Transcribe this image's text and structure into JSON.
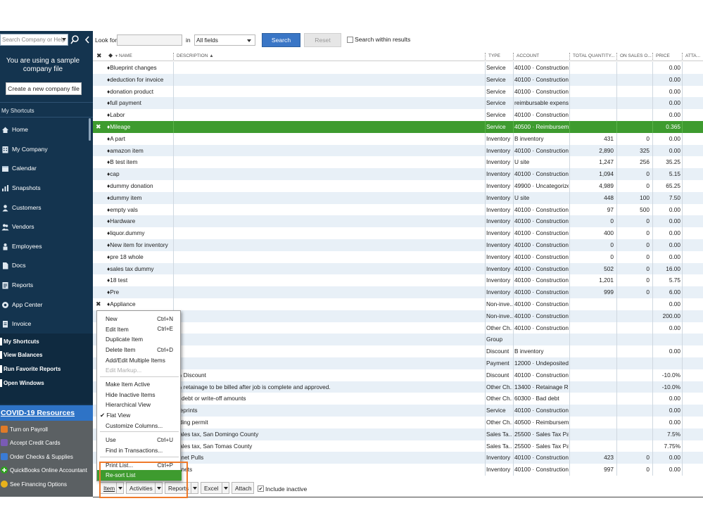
{
  "sidebar": {
    "search_placeholder": "Search Company or Help",
    "sample_notice": "You are using a sample company file",
    "create_button": "Create a new company file",
    "my_shortcuts_heading": "My Shortcuts",
    "nav": [
      {
        "label": "Home",
        "icon": "home-icon"
      },
      {
        "label": "My Company",
        "icon": "building-icon"
      },
      {
        "label": "Calendar",
        "icon": "calendar-icon"
      },
      {
        "label": "Snapshots",
        "icon": "snapshot-icon"
      },
      {
        "label": "Customers",
        "icon": "customer-icon"
      },
      {
        "label": "Vendors",
        "icon": "vendor-icon"
      },
      {
        "label": "Employees",
        "icon": "employee-icon"
      },
      {
        "label": "Docs",
        "icon": "docs-icon"
      },
      {
        "label": "Reports",
        "icon": "reports-icon"
      },
      {
        "label": "App Center",
        "icon": "app-center-icon"
      },
      {
        "label": "Invoice",
        "icon": "invoice-icon"
      }
    ],
    "lower": [
      "My Shortcuts",
      "View Balances",
      "Run Favorite Reports",
      "Open Windows"
    ],
    "covid_heading": "COVID-19 Resources",
    "covid_items": [
      {
        "label": "Turn on Payroll",
        "color": "#e07b28"
      },
      {
        "label": "Accept Credit Cards",
        "color": "#7a5bb5"
      },
      {
        "label": "Order Checks & Supplies",
        "color": "#3a7bd5"
      },
      {
        "label": "QuickBooks Online Accountant",
        "color": "#2ca01c"
      },
      {
        "label": "See Financing Options",
        "color": "#e8b21b"
      }
    ]
  },
  "search": {
    "look_for": "Look for",
    "in": "in",
    "fields_value": "All fields",
    "search_button": "Search",
    "reset_button": "Reset",
    "within_label": "Search within results"
  },
  "table": {
    "headers": {
      "name": "NAME",
      "description": "DESCRIPTION ▲",
      "type": "TYPE",
      "account": "ACCOUNT",
      "total_qty": "TOTAL QUANTITY...",
      "on_sales": "ON SALES O...",
      "price": "PRICE",
      "attach": "ATTA..."
    },
    "rows": [
      {
        "mark": "",
        "name": "♦Blueprint changes",
        "desc": "",
        "type": "Service",
        "account": "40100 · Construction ...",
        "qty": "",
        "onso": "",
        "price": "0.00"
      },
      {
        "mark": "",
        "name": "♦deduction for invoice",
        "desc": "",
        "type": "Service",
        "account": "40100 · Construction ...",
        "qty": "",
        "onso": "",
        "price": "0.00"
      },
      {
        "mark": "",
        "name": "♦donation product",
        "desc": "",
        "type": "Service",
        "account": "40100 · Construction ...",
        "qty": "",
        "onso": "",
        "price": "0.00"
      },
      {
        "mark": "",
        "name": "♦full payment",
        "desc": "",
        "type": "Service",
        "account": "reimbursable expense",
        "qty": "",
        "onso": "",
        "price": "0.00"
      },
      {
        "mark": "",
        "name": "♦Labor",
        "desc": "",
        "type": "Service",
        "account": "40100 · Construction ...",
        "qty": "",
        "onso": "",
        "price": "0.00"
      },
      {
        "mark": "✖",
        "name": "♦Mileage",
        "desc": "",
        "type": "Service",
        "account": "40500 · Reimbursem...",
        "qty": "",
        "onso": "",
        "price": "0.365",
        "selected": true
      },
      {
        "mark": "",
        "name": "♦A part",
        "desc": "",
        "type": "Inventory ...",
        "account": "B inventory",
        "qty": "431",
        "onso": "0",
        "price": "0.00"
      },
      {
        "mark": "",
        "name": "♦amazon item",
        "desc": "",
        "type": "Inventory ...",
        "account": "40100 · Construction ...",
        "qty": "2,890",
        "onso": "325",
        "price": "0.00"
      },
      {
        "mark": "",
        "name": "♦B test item",
        "desc": "",
        "type": "Inventory ...",
        "account": "U site",
        "qty": "1,247",
        "onso": "256",
        "price": "35.25"
      },
      {
        "mark": "",
        "name": "♦cap",
        "desc": "",
        "type": "Inventory ...",
        "account": "40100 · Construction ...",
        "qty": "1,094",
        "onso": "0",
        "price": "5.15"
      },
      {
        "mark": "",
        "name": "♦dummy donation",
        "desc": "",
        "type": "Inventory ...",
        "account": "49900 · Uncategorize...",
        "qty": "4,989",
        "onso": "0",
        "price": "65.25"
      },
      {
        "mark": "",
        "name": "♦dummy item",
        "desc": "",
        "type": "Inventory ...",
        "account": "U site",
        "qty": "448",
        "onso": "100",
        "price": "7.50"
      },
      {
        "mark": "",
        "name": "♦empty vals",
        "desc": "",
        "type": "Inventory ...",
        "account": "40100 · Construction ...",
        "qty": "97",
        "onso": "500",
        "price": "0.00"
      },
      {
        "mark": "",
        "name": "♦Hardware",
        "desc": "",
        "type": "Inventory ...",
        "account": "40100 · Construction ...",
        "qty": "0",
        "onso": "0",
        "price": "0.00"
      },
      {
        "mark": "",
        "name": "♦liquor.dummy",
        "desc": "",
        "type": "Inventory ...",
        "account": "40100 · Construction ...",
        "qty": "400",
        "onso": "0",
        "price": "0.00"
      },
      {
        "mark": "",
        "name": "♦New item for inventory",
        "desc": "",
        "type": "Inventory ...",
        "account": "40100 · Construction ...",
        "qty": "0",
        "onso": "0",
        "price": "0.00"
      },
      {
        "mark": "",
        "name": "♦pre 18 whole",
        "desc": "",
        "type": "Inventory ...",
        "account": "40100 · Construction ...",
        "qty": "0",
        "onso": "0",
        "price": "0.00"
      },
      {
        "mark": "",
        "name": "♦sales tax dummy",
        "desc": "",
        "type": "Inventory ...",
        "account": "40100 · Construction ...",
        "qty": "502",
        "onso": "0",
        "price": "16.00"
      },
      {
        "mark": "",
        "name": "♦18 test",
        "desc": "",
        "type": "Inventory ...",
        "account": "40100 · Construction ...",
        "qty": "1,201",
        "onso": "0",
        "price": "5.75"
      },
      {
        "mark": "",
        "name": "♦Pre",
        "desc": "",
        "type": "Inventory ...",
        "account": "40100 · Construction ...",
        "qty": "999",
        "onso": "0",
        "price": "6.00"
      },
      {
        "mark": "✖",
        "name": "♦Appliance",
        "desc": "",
        "type": "Non-inve...",
        "account": "40100 · Construction ...",
        "qty": "",
        "onso": "",
        "price": "0.00"
      },
      {
        "mark": "",
        "name": "",
        "desc": "",
        "type": "Non-inve...",
        "account": "40100 · Construction ...",
        "qty": "",
        "onso": "",
        "price": "200.00"
      },
      {
        "mark": "",
        "name": "",
        "desc": "",
        "type": "Other Ch...",
        "account": "40100 · Construction ...",
        "qty": "",
        "onso": "",
        "price": "0.00"
      },
      {
        "mark": "",
        "name": "",
        "desc": "",
        "type": "Group",
        "account": "",
        "qty": "",
        "onso": "",
        "price": ""
      },
      {
        "mark": "",
        "name": "",
        "desc": "",
        "type": "Discount",
        "account": "B inventory",
        "qty": "",
        "onso": "",
        "price": "0.00"
      },
      {
        "mark": "",
        "name": "",
        "desc": "",
        "type": "Payment",
        "account": "12000 · Undeposited...",
        "qty": "",
        "onso": "",
        "price": ""
      },
      {
        "mark": "",
        "name": "",
        "desc": "% Discount",
        "type": "Discount",
        "account": "40100 · Construction ...",
        "qty": "",
        "onso": "",
        "price": "-10.0%"
      },
      {
        "mark": "",
        "name": "",
        "desc": "% retainage to be billed after job is complete and approved.",
        "type": "Other Ch...",
        "account": "13400 · Retainage R...",
        "qty": "",
        "onso": "",
        "price": "-10.0%"
      },
      {
        "mark": "",
        "name": "",
        "desc": "d debt or write-off amounts",
        "type": "Other Ch...",
        "account": "60300 · Bad debt",
        "qty": "",
        "onso": "",
        "price": "0.00"
      },
      {
        "mark": "",
        "name": "",
        "desc": "ueprints",
        "type": "Service",
        "account": "40100 · Construction ...",
        "qty": "",
        "onso": "",
        "price": "0.00"
      },
      {
        "mark": "",
        "name": "",
        "desc": "ilding permit",
        "type": "Other Ch...",
        "account": "40500 · Reimbursem...",
        "qty": "",
        "onso": "",
        "price": "0.00"
      },
      {
        "mark": "",
        "name": "",
        "desc": "sales tax, San Domingo County",
        "type": "Sales Ta...",
        "account": "25500 · Sales Tax Pa...",
        "qty": "",
        "onso": "",
        "price": "7.5%"
      },
      {
        "mark": "",
        "name": "",
        "desc": "sales tax, San Tomas County",
        "type": "Sales Ta...",
        "account": "25500 · Sales Tax Pa...",
        "qty": "",
        "onso": "",
        "price": "7.75%"
      },
      {
        "mark": "",
        "name": "",
        "desc": "binet Pulls",
        "type": "Inventory ...",
        "account": "40100 · Construction ...",
        "qty": "423",
        "onso": "0",
        "price": "0.00"
      },
      {
        "mark": "",
        "name": "",
        "desc": "binets",
        "type": "Inventory ...",
        "account": "40100 · Construction ...",
        "qty": "997",
        "onso": "0",
        "price": "0.00"
      }
    ]
  },
  "context_menu": {
    "items": [
      {
        "label": "New",
        "shortcut": "Ctrl+N"
      },
      {
        "label": "Edit Item",
        "shortcut": "Ctrl+E"
      },
      {
        "label": "Duplicate Item",
        "shortcut": ""
      },
      {
        "label": "Delete Item",
        "shortcut": "Ctrl+D"
      },
      {
        "label": "Add/Edit Multiple Items",
        "shortcut": ""
      },
      {
        "label": "Edit Markup...",
        "shortcut": "",
        "disabled": true
      },
      {
        "label": "Make Item Active",
        "shortcut": ""
      },
      {
        "label": "Hide Inactive Items",
        "shortcut": ""
      },
      {
        "label": "Hierarchical View",
        "shortcut": ""
      },
      {
        "label": "✔ Flat View",
        "shortcut": ""
      },
      {
        "label": "Customize Columns...",
        "shortcut": ""
      },
      {
        "label": "Use",
        "shortcut": "Ctrl+U"
      },
      {
        "label": "Find in Transactions...",
        "shortcut": ""
      },
      {
        "label": "Print List...",
        "shortcut": "Ctrl+P"
      },
      {
        "label": "Re-sort List",
        "shortcut": "",
        "highlighted": true
      }
    ]
  },
  "bottom_bar": {
    "item": "Item",
    "activities": "Activities",
    "reports": "Reports",
    "excel": "Excel",
    "attach": "Attach",
    "include_inactive": "Include inactive"
  }
}
